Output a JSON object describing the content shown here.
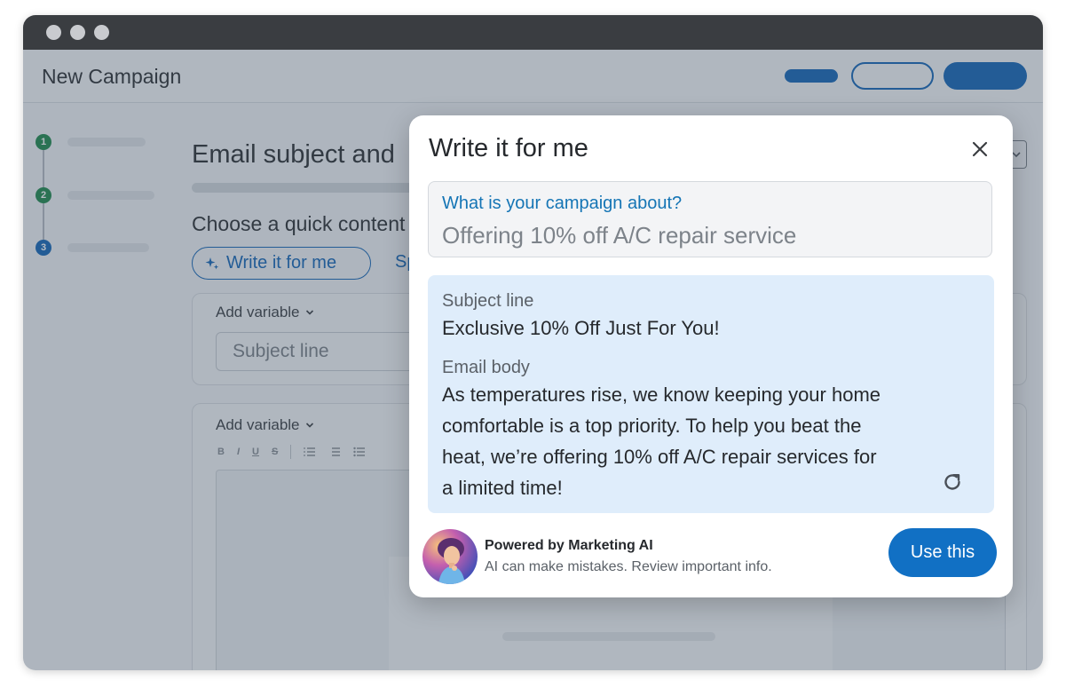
{
  "app": {
    "title": "New Campaign"
  },
  "main": {
    "section_title": "Email subject and",
    "choose_text": "Choose a quick content",
    "write_pill_label": "Write it for me",
    "sp_link": "Sp",
    "subject_card": {
      "add_variable": "Add variable",
      "subject_placeholder": "Subject line"
    },
    "body_card": {
      "add_variable": "Add variable"
    },
    "steps": [
      "1",
      "2",
      "3"
    ],
    "toolbar": [
      "B",
      "I",
      "U",
      "S"
    ]
  },
  "modal": {
    "title": "Write it for me",
    "prompt_label": "What is your campaign about?",
    "prompt_value": "Offering 10% off A/C repair service",
    "subject_label": "Subject line",
    "subject_value": "Exclusive 10% Off Just For You!",
    "body_label": "Email body",
    "body_value": "As temperatures rise, we know keeping your home comfortable is a top priority. To help you beat the heat, we’re offering 10% off A/C repair services for a limited time!",
    "powered_by": "Powered by Marketing AI",
    "disclaimer": "AI can make mistakes. Review important info.",
    "use_button": "Use this"
  },
  "colors": {
    "accent": "#1466b8",
    "primary_button": "#1170c4",
    "result_bg": "#dfedfb",
    "step_done": "#1f8a4c"
  },
  "icons": {
    "close": "close-icon",
    "refresh": "refresh-icon",
    "sparkle": "sparkle-icon",
    "chevron": "chevron-down-icon"
  }
}
